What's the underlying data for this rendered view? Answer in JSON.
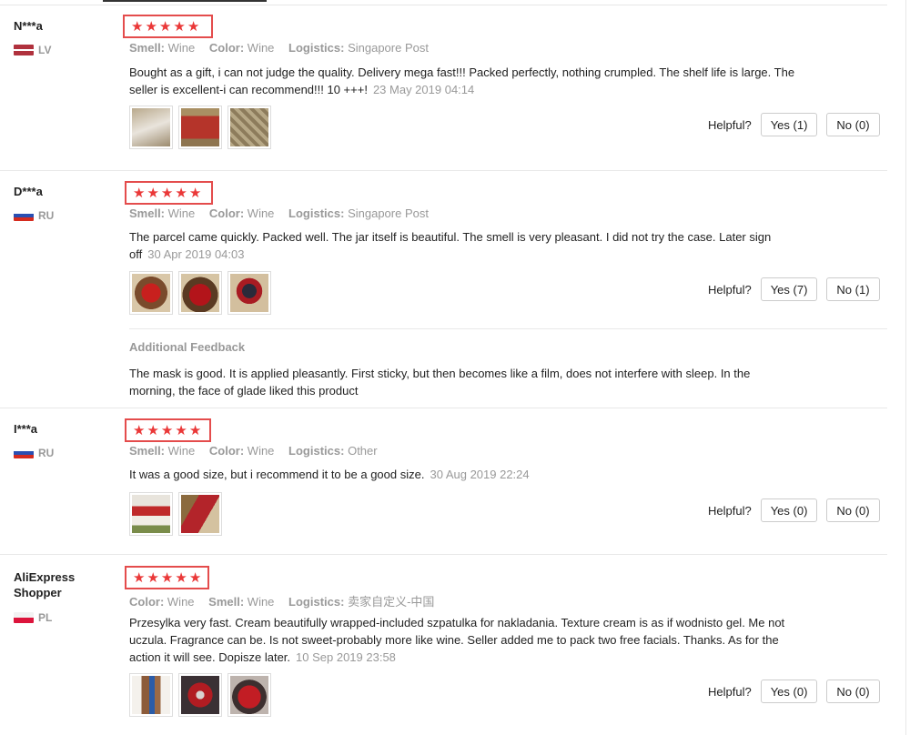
{
  "helpful_label": "Helpful?",
  "star_glyph": "★",
  "reviews": [
    {
      "user": "N***a",
      "country": "LV",
      "attrs": [
        {
          "label": "Smell:",
          "value": "Wine"
        },
        {
          "label": "Color:",
          "value": "Wine"
        },
        {
          "label": "Logistics:",
          "value": "Singapore Post"
        }
      ],
      "text": "Bought as a gift, i can not judge the quality. Delivery mega fast!!! Packed perfectly, nothing crumpled. The shelf life is large. The seller is excellent-i can recommend!!! 10 +++!",
      "date": "23 May 2019 04:14",
      "yes": "Yes (1)",
      "no": "No (0)"
    },
    {
      "user": "D***a",
      "country": "RU",
      "attrs": [
        {
          "label": "Smell:",
          "value": "Wine"
        },
        {
          "label": "Color:",
          "value": "Wine"
        },
        {
          "label": "Logistics:",
          "value": "Singapore Post"
        }
      ],
      "text": "The parcel came quickly. Packed well. The jar itself is beautiful. The smell is very pleasant. I did not try the case. Later sign off",
      "date": "30 Apr 2019 04:03",
      "yes": "Yes (7)",
      "no": "No (1)",
      "additional_title": "Additional Feedback",
      "additional_text": "The mask is good. It is applied pleasantly. First sticky, but then becomes like a film, does not interfere with sleep. In the morning, the face of glade liked this product"
    },
    {
      "user": "I***a",
      "country": "RU",
      "attrs": [
        {
          "label": "Smell:",
          "value": "Wine"
        },
        {
          "label": "Color:",
          "value": "Wine"
        },
        {
          "label": "Logistics:",
          "value": "Other"
        }
      ],
      "text": "It was a good size, but i recommend it to be a good size.",
      "date": "30 Aug 2019 22:24",
      "yes": "Yes (0)",
      "no": "No (0)"
    },
    {
      "user": "AliExpress Shopper",
      "country": "PL",
      "attrs": [
        {
          "label": "Color:",
          "value": "Wine"
        },
        {
          "label": "Smell:",
          "value": "Wine"
        },
        {
          "label": "Logistics:",
          "value": "卖家自定义-中国"
        }
      ],
      "text": "Przesylka very fast. Cream beautifully wrapped-included szpatulka for nakladania. Texture cream is as if wodnisto gel. Me not uczula. Fragrance can be. Is not sweet-probably more like wine. Seller added me to pack two free facials. Thanks. As for the action it will see. Dopisze later.",
      "date": "10 Sep 2019 23:58",
      "yes": "Yes (0)",
      "no": "No (0)"
    }
  ]
}
